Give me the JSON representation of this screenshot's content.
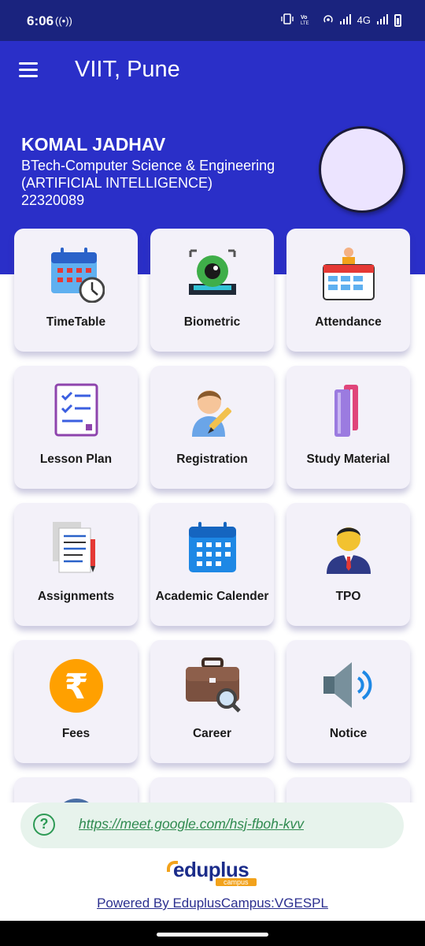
{
  "status_bar": {
    "time": "6:06",
    "left_icon": "((•))",
    "network": "4G",
    "icons": [
      "vibrate-icon",
      "volte-icon",
      "hotspot-icon",
      "signal-icon",
      "signal-icon",
      "battery-icon"
    ],
    "color": "#1a237e"
  },
  "app_bar": {
    "title": "VIIT, Pune",
    "color": "#2a2fc8"
  },
  "profile": {
    "name": "KOMAL JADHAV",
    "course": "BTech-Computer Science & Engineering",
    "specialization": "(ARTIFICIAL INTELLIGENCE)",
    "id": "22320089",
    "avatar_color": "#ece4ff"
  },
  "tiles": [
    {
      "label": "TimeTable",
      "icon": "calendar-clock-icon"
    },
    {
      "label": "Biometric",
      "icon": "eye-scan-icon"
    },
    {
      "label": "Attendance",
      "icon": "attendance-board-icon"
    },
    {
      "label": "Lesson Plan",
      "icon": "checklist-icon"
    },
    {
      "label": "Registration",
      "icon": "user-pencil-icon"
    },
    {
      "label": "Study Material",
      "icon": "books-icon"
    },
    {
      "label": "Assignments",
      "icon": "document-pencil-icon"
    },
    {
      "label": "Academic Calender",
      "icon": "calendar-icon"
    },
    {
      "label": "TPO",
      "icon": "officer-icon"
    },
    {
      "label": "Fees",
      "icon": "rupee-icon"
    },
    {
      "label": "Career",
      "icon": "briefcase-search-icon"
    },
    {
      "label": "Notice",
      "icon": "speaker-icon"
    }
  ],
  "meet_link": {
    "url": "https://meet.google.com/hsj-fboh-kvv",
    "icon": "help-circle-icon"
  },
  "logo": {
    "word": "eduplus",
    "tag": "campus",
    "accent": "#f2a21b",
    "brand": "#1b2c8a"
  },
  "powered_by": "Powered By EduplusCampus:VGESPL"
}
